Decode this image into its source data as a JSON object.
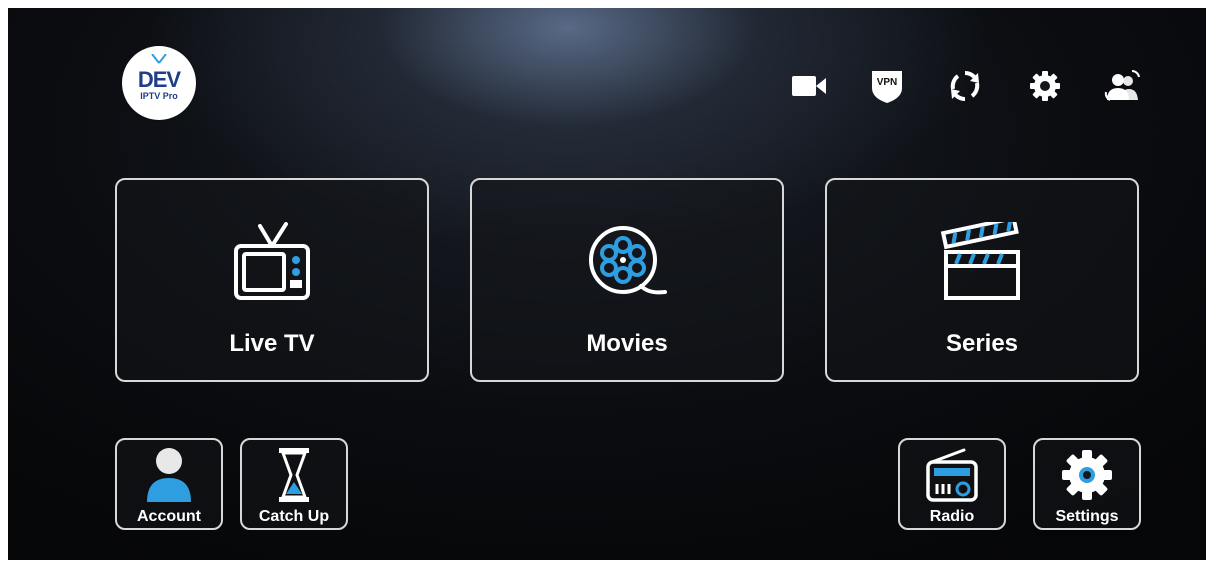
{
  "logo": {
    "main": "DEV",
    "sub": "IPTV Pro"
  },
  "top_icons": [
    "video-camera-icon",
    "vpn-shield-icon",
    "refresh-icon",
    "gear-icon",
    "switch-user-icon"
  ],
  "vpn_label": "VPN",
  "tiles": {
    "live_tv": {
      "label": "Live TV",
      "icon": "tv-icon"
    },
    "movies": {
      "label": "Movies",
      "icon": "film-reel-icon"
    },
    "series": {
      "label": "Series",
      "icon": "clapperboard-icon"
    }
  },
  "shortcuts": {
    "account": {
      "label": "Account",
      "icon": "user-icon"
    },
    "catch_up": {
      "label": "Catch Up",
      "icon": "hourglass-icon"
    },
    "radio": {
      "label": "Radio",
      "icon": "radio-icon"
    },
    "settings": {
      "label": "Settings",
      "icon": "gear-icon"
    }
  },
  "colors": {
    "accent": "#2f9ee0",
    "border": "#d8d8d8",
    "text": "#ffffff"
  }
}
